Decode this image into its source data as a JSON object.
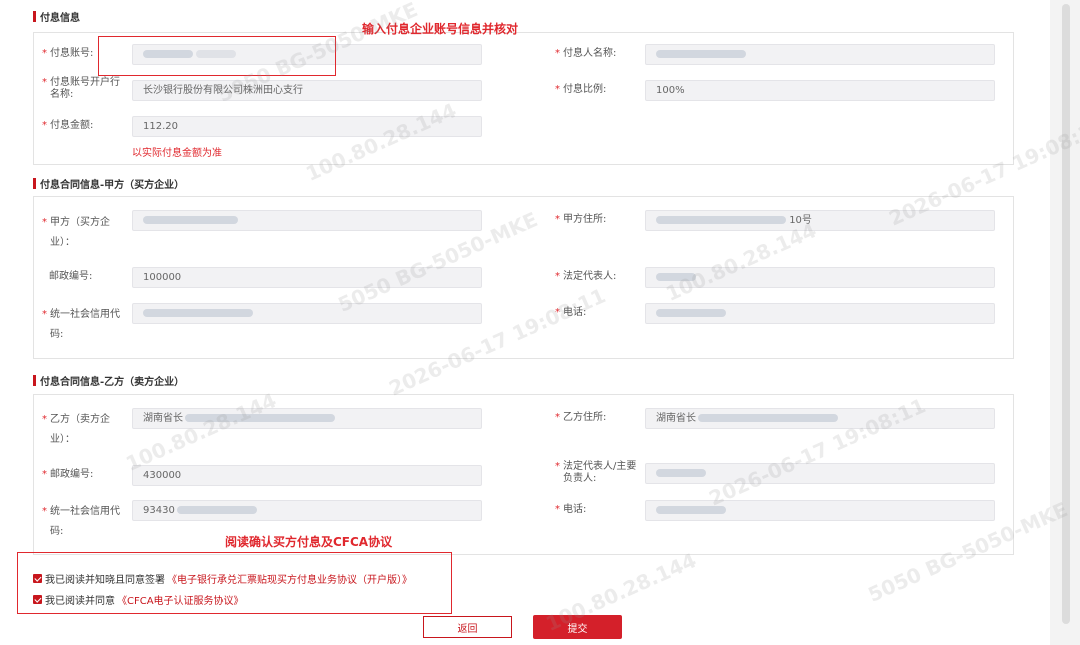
{
  "annotations": {
    "top": "输入付息企业账号信息并核对",
    "bottom": "阅读确认买方付息及CFCA协议"
  },
  "section_payer": {
    "title": "付息信息",
    "account_label": "付息账号:",
    "account_value": "",
    "payer_name_label": "付息人名称:",
    "payer_name_value": "",
    "bank_label_line1": "付息账号开户行",
    "bank_label_line2": "名称:",
    "bank_value": "长沙银行股份有限公司株洲田心支行",
    "ratio_label": "付息比例:",
    "ratio_value": "100%",
    "amount_label": "付息金额:",
    "amount_value": "112.20",
    "amount_hint": "以实际付息金额为准"
  },
  "section_party_a": {
    "title": "付息合同信息-甲方（买方企业）",
    "name_label_line1": "甲方（买方企",
    "name_label_line2": "业）：",
    "name_value": "",
    "address_label": "甲方住所:",
    "address_value": "10号",
    "postcode_label": "邮政编号:",
    "postcode_value": "100000",
    "legal_rep_label": "法定代表人:",
    "legal_rep_value": "",
    "credit_code_label_line1": "统一社会信用代",
    "credit_code_label_line2": "码:",
    "credit_code_value": "",
    "phone_label": "电话:",
    "phone_value": ""
  },
  "section_party_b": {
    "title": "付息合同信息-乙方（卖方企业）",
    "name_label_line1": "乙方（卖方企",
    "name_label_line2": "业）：",
    "name_value": "湖南省长",
    "address_label": "乙方住所:",
    "address_value": "湖南省长",
    "postcode_label": "邮政编号:",
    "postcode_value": "430000",
    "legal_rep_label_line1": "法定代表人/主要",
    "legal_rep_label_line2": "负责人:",
    "legal_rep_value": "",
    "credit_code_label_line1": "统一社会信用代",
    "credit_code_label_line2": "码:",
    "credit_code_value": "93430",
    "phone_label": "电话:",
    "phone_value": ""
  },
  "agreements": {
    "item1_text": "我已阅读并知晓且同意签署",
    "item1_link": "《电子银行承兑汇票贴现买方付息业务协议（开户版）》",
    "item2_text": "我已阅读并同意",
    "item2_link": "《CFCA电子认证服务协议》"
  },
  "buttons": {
    "back": "返回",
    "submit": "提交"
  },
  "watermark": {
    "line1": "5050  BG-5050-MKE",
    "line2": "100.80.28.144",
    "line3": "2026-06-17  19:08:11"
  },
  "colors": {
    "accent": "#c8161d",
    "annotation": "#e0282e",
    "field_bg": "#f2f2f4"
  }
}
